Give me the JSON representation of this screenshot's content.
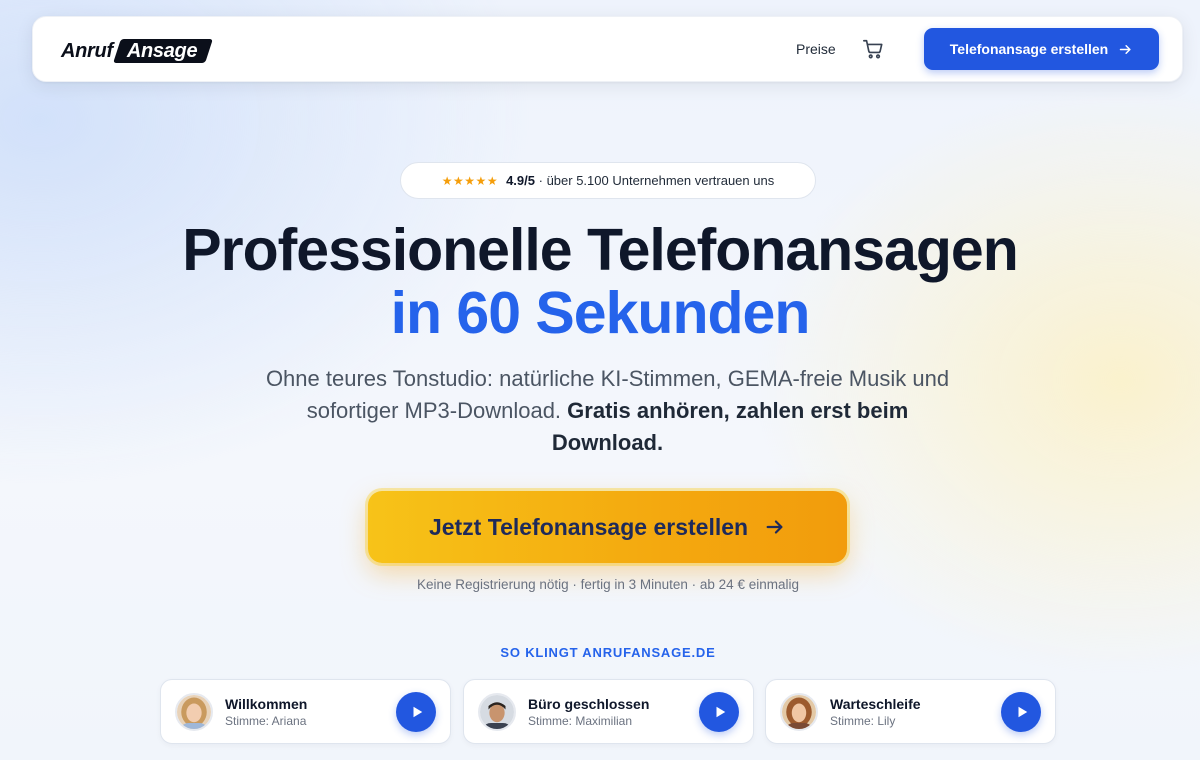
{
  "header": {
    "logo": {
      "part1": "Anruf",
      "part2": "Ansage"
    },
    "nav_price": "Preise",
    "cart_icon": "shopping-cart-icon",
    "cta_label": "Telefonansage erstellen",
    "cta_icon": "arrow-right-icon"
  },
  "rating": {
    "stars": "★★★★★",
    "score": "4.9/5",
    "text": "· über 5.100 Unternehmen vertrauen uns"
  },
  "hero": {
    "title_line1": "Professionelle Telefonansagen",
    "title_line2": "in 60 Sekunden",
    "subtitle_plain": "Ohne teures Tonstudio: natürliche KI-Stimmen, GEMA-freie Musik und sofortiger MP3-Download.",
    "subtitle_bold": "Gratis anhören, zahlen erst beim Download.",
    "cta_label": "Jetzt Telefonansage erstellen",
    "cta_note": "Keine Registrierung nötig · fertig in 3 Minuten · ab 24 € einmalig"
  },
  "samples": {
    "title": "SO KLINGT ANRUFANSAGE.DE",
    "items": [
      {
        "title": "Willkommen",
        "voice": "Stimme: Ariana"
      },
      {
        "title": "Büro geschlossen",
        "voice": "Stimme: Maximilian"
      },
      {
        "title": "Warteschleife",
        "voice": "Stimme: Lily"
      }
    ]
  },
  "colors": {
    "primary": "#2257e0",
    "accent_blue_text": "#2563eb",
    "cta_yellow": "#f7c318",
    "cta_orange": "#f29c0c",
    "star": "#f59e0b"
  }
}
